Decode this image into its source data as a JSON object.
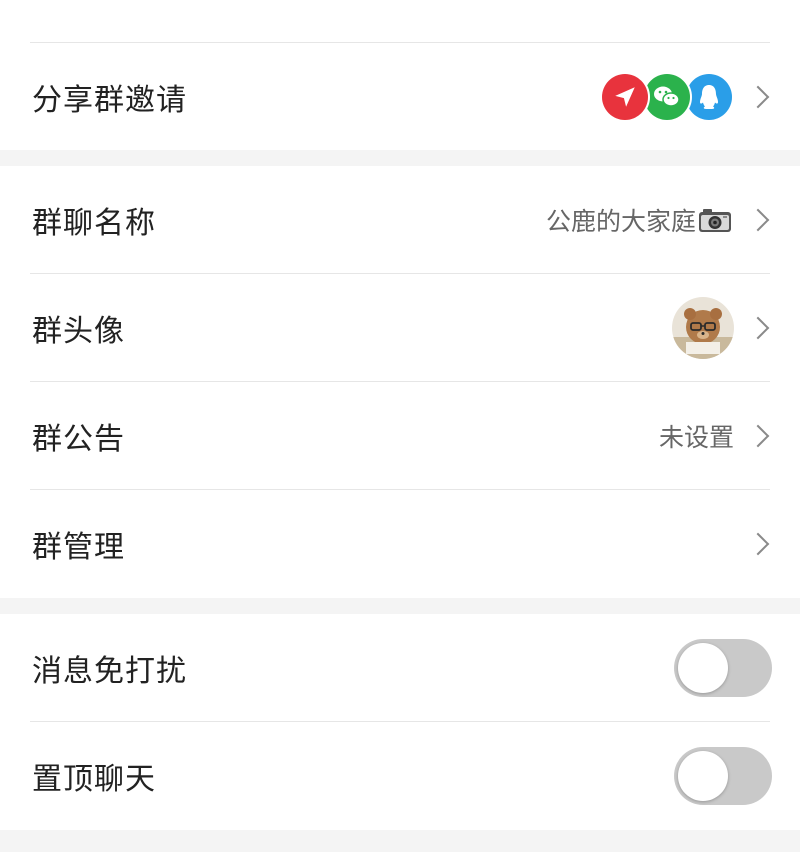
{
  "share_invite": {
    "label": "分享群邀请",
    "icons": [
      "send-icon",
      "wechat-icon",
      "qq-icon"
    ],
    "colors": {
      "send": "#e8333d",
      "wechat": "#2bb24c",
      "qq": "#2a9ee8"
    }
  },
  "group_name": {
    "label": "群聊名称",
    "value": "公鹿的大家庭"
  },
  "group_avatar": {
    "label": "群头像"
  },
  "group_notice": {
    "label": "群公告",
    "value": "未设置"
  },
  "group_manage": {
    "label": "群管理"
  },
  "mute": {
    "label": "消息免打扰",
    "enabled": false
  },
  "pin": {
    "label": "置顶聊天",
    "enabled": false
  }
}
